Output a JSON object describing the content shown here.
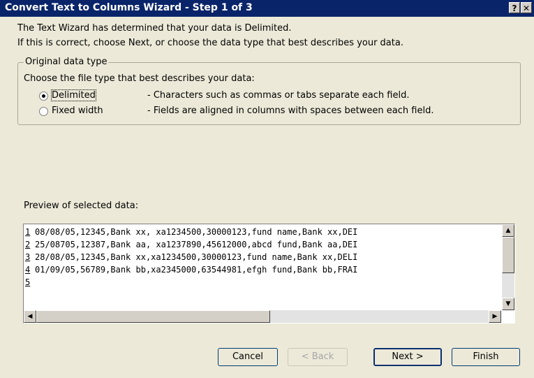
{
  "window": {
    "title": "Convert Text to Columns Wizard - Step 1 of 3",
    "help_label": "?",
    "close_label": "✕"
  },
  "intro": {
    "line1": "The Text Wizard has determined that your data is Delimited.",
    "line2": "If this is correct, choose Next, or choose the data type that best describes your data."
  },
  "original_data_type": {
    "legend": "Original data type",
    "prompt": "Choose the file type that best describes your data:",
    "options": [
      {
        "label": "Delimited",
        "description": "- Characters such as commas or tabs separate each field.",
        "selected": true
      },
      {
        "label": "Fixed width",
        "description": "- Fields are aligned in columns with spaces between each field.",
        "selected": false
      }
    ]
  },
  "preview": {
    "label": "Preview of selected data:",
    "rows": [
      {
        "num": "1",
        "text": "08/08/05,12345,Bank xx, xa1234500,30000123,fund name,Bank xx,DEI"
      },
      {
        "num": "2",
        "text": "25/08705,12387,Bank aa, xa1237890,45612000,abcd fund,Bank aa,DEI"
      },
      {
        "num": "3",
        "text": "28/08/05,12345,Bank xx,xa1234500,30000123,fund name,Bank xx,DELI"
      },
      {
        "num": "4",
        "text": "01/09/05,56789,Bank bb,xa2345000,63544981,efgh fund,Bank bb,FRAI"
      },
      {
        "num": "5",
        "text": ""
      }
    ]
  },
  "buttons": {
    "cancel": "Cancel",
    "back": "< Back",
    "next": "Next >",
    "finish": "Finish"
  },
  "colors": {
    "titlebar": "#0a246a",
    "dialog": "#ece9d8"
  }
}
